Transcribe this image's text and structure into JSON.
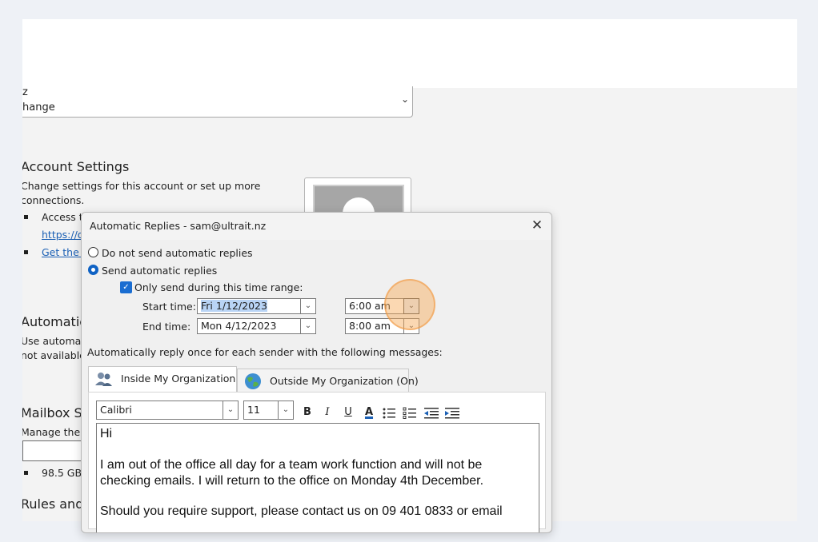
{
  "background": {
    "combo_line1": "z",
    "combo_line2": "hange",
    "account_settings_title": "Account Settings",
    "account_settings_desc1": "Change settings for this account or set up more",
    "account_settings_desc2": "connections.",
    "bullet1_text": "Access th",
    "bullet1_link": "https://o",
    "bullet2_link": "Get the C",
    "automatic_title": "Automatic",
    "automatic_desc1": "Use automati",
    "automatic_desc2": "not available",
    "mailbox_title": "Mailbox Se",
    "mailbox_desc": "Manage the s",
    "mailbox_size": "98.5 GB f",
    "rules_title": "Rules and"
  },
  "dialog": {
    "title": "Automatic Replies - sam@ultrait.nz",
    "close_icon": "close-icon",
    "option_no_replies": "Do not send automatic replies",
    "option_send_replies": "Send automatic replies",
    "selected_option": "send",
    "time_range_label": "Only send during this time range:",
    "time_range_checked": true,
    "start_label": "Start time:",
    "start_date": "Fri 1/12/2023",
    "start_time": "6:00 am",
    "end_label": "End time:",
    "end_date": "Mon 4/12/2023",
    "end_time": "8:00 am",
    "reply_once_text": "Automatically reply once for each sender with the following messages:",
    "tabs": [
      {
        "label": "Inside My Organization",
        "active": true,
        "icon": "people-icon"
      },
      {
        "label": "Outside My Organization (On)",
        "active": false,
        "icon": "globe-icon"
      }
    ],
    "toolbar": {
      "font": "Calibri",
      "size": "11",
      "bold": "B",
      "italic": "I",
      "underline": "U",
      "font_color": "A",
      "accent_color": "#1a5fb4"
    },
    "message_lines": [
      "Hi",
      "",
      "I am out of the office all day for a team work function and will not be",
      "checking emails. I will return to the office on Monday 4th December.",
      "",
      "Should you require support, please contact us on 09 401 0833 or email"
    ]
  }
}
